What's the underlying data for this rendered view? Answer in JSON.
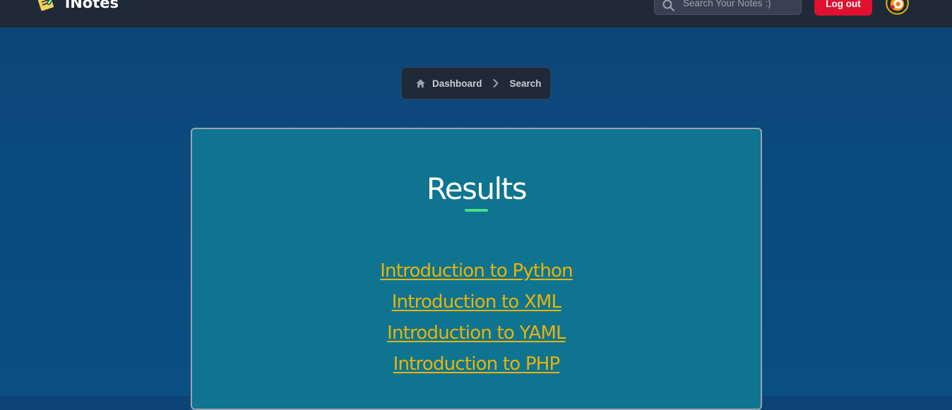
{
  "app": {
    "brand_name": "iNotes",
    "logo_icon": "notepad-icon"
  },
  "header": {
    "search_placeholder": "Search Your Notes :)",
    "search_icon": "search-icon",
    "logout_label": "Log out",
    "avatar_icon": "user-avatar-icon"
  },
  "breadcrumb": {
    "items": [
      {
        "label": "Dashboard",
        "icon": "home-icon"
      },
      {
        "label": "Search"
      }
    ],
    "separator_icon": "chevron-right-icon"
  },
  "results": {
    "title": "Results",
    "items": [
      {
        "label": "Introduction to Python"
      },
      {
        "label": "Introduction to XML"
      },
      {
        "label": "Introduction to YAML"
      },
      {
        "label": "Introduction to PHP"
      }
    ]
  },
  "colors": {
    "navbar_bg": "#1f2937",
    "page_bg": "#0b4a7d",
    "card_bg": "#0e7490",
    "link_color": "#eab308",
    "underline_accent": "#4ade80",
    "logout_bg": "#e0102f"
  }
}
